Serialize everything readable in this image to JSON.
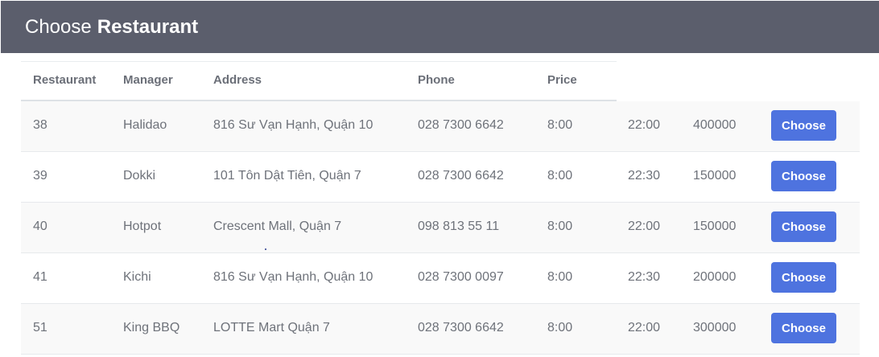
{
  "header": {
    "title_light": "Choose",
    "title_bold": "Restaurant"
  },
  "table": {
    "columns": [
      "Restaurant",
      "Manager",
      "Address",
      "Phone",
      "Price"
    ],
    "rows": [
      {
        "id": "38",
        "manager": "Halidao",
        "address": "816 Sư Vạn Hạnh, Quận 10",
        "phone": "028 7300 6642",
        "open": "8:00",
        "close": "22:00",
        "price": "400000",
        "action": "Choose"
      },
      {
        "id": "39",
        "manager": "Dokki",
        "address": "101 Tôn Dật Tiên, Quận 7",
        "phone": "028 7300 6642",
        "open": "8:00",
        "close": "22:30",
        "price": "150000",
        "action": "Choose"
      },
      {
        "id": "40",
        "manager": "Hotpot",
        "address": "Crescent Mall, Quận 7",
        "phone": "098 813 55 11",
        "open": "8:00",
        "close": "22:00",
        "price": "150000",
        "action": "Choose"
      },
      {
        "id": "41",
        "manager": "Kichi",
        "address": "816 Sư Vạn Hạnh, Quận 10",
        "phone": "028 7300 0097",
        "open": "8:00",
        "close": "22:30",
        "price": "200000",
        "action": "Choose"
      },
      {
        "id": "51",
        "manager": "King BBQ",
        "address": "LOTTE Mart Quận 7",
        "phone": "028 7300 6642",
        "open": "8:00",
        "close": "22:00",
        "price": "300000",
        "action": "Choose"
      }
    ]
  }
}
